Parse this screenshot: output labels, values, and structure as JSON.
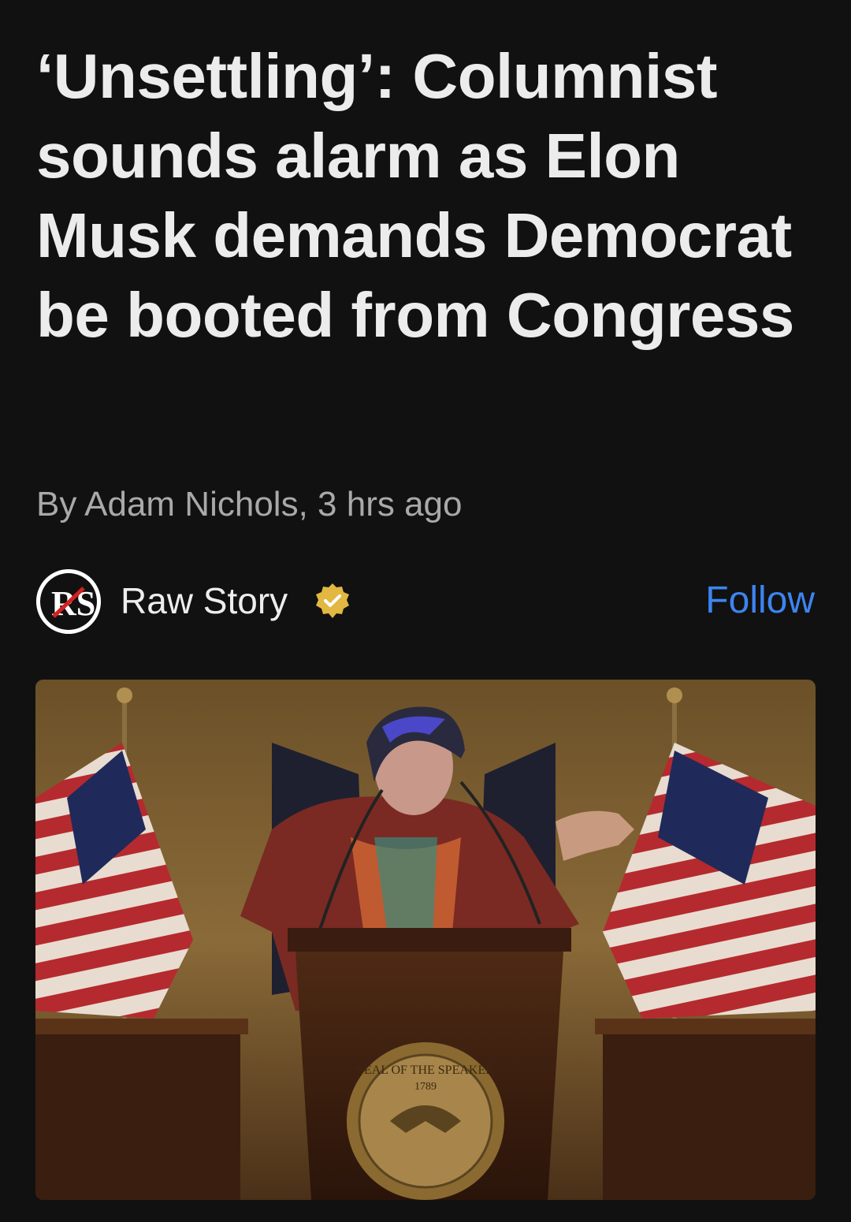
{
  "article": {
    "headline": "‘Unsettling’: Columnist sounds alarm as Elon Musk demands Democrat be booted from Congress",
    "byline": "By Adam Nichols, 3 hrs ago"
  },
  "publisher": {
    "logo_text": "RS",
    "name": "Raw Story",
    "verified_icon": "verified-badge-icon",
    "follow_label": "Follow"
  },
  "image": {
    "seal_text": "SEAL OF THE SPEAKER",
    "seal_year": "1789"
  },
  "colors": {
    "background": "#111111",
    "headline": "#ececec",
    "byline": "#a9a9a9",
    "follow": "#3d84f0",
    "verified": "#e2b742"
  }
}
